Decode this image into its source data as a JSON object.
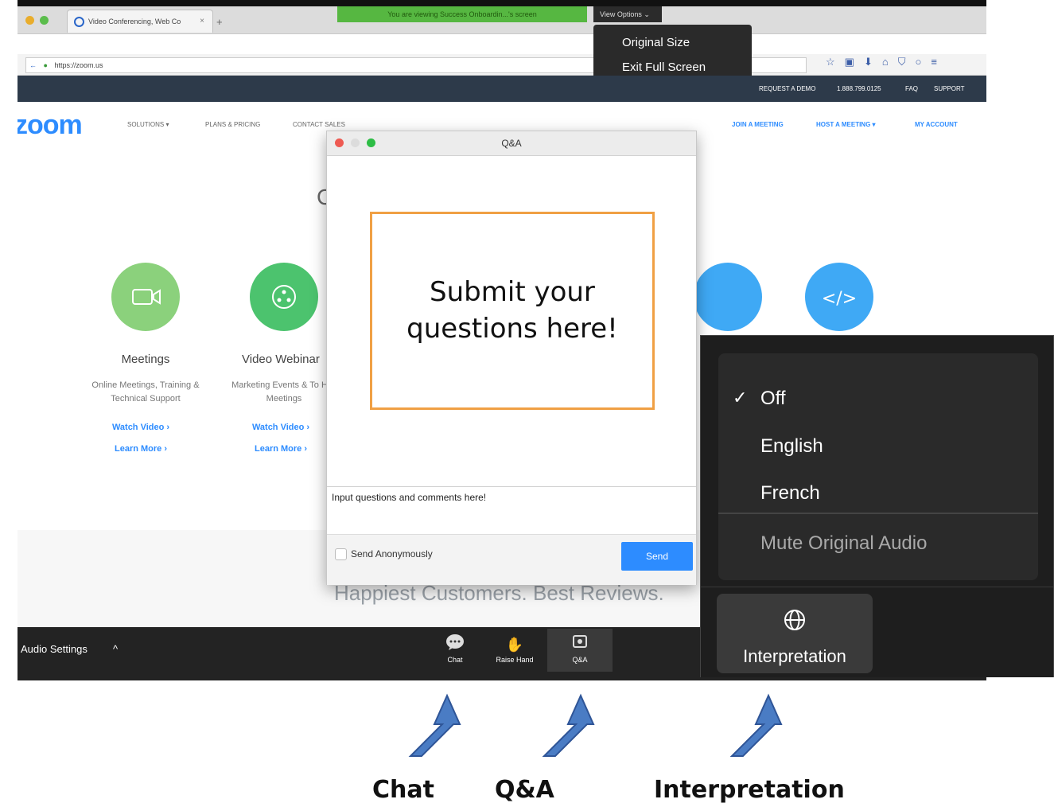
{
  "browser": {
    "tab_title": "Video Conferencing, Web Co",
    "tab_close": "×",
    "new_tab": "+",
    "url": "https://zoom.us",
    "share_notice": "You are viewing Success Onboardin...'s screen",
    "view_options": "View Options ⌄",
    "view_menu": [
      "Original Size",
      "Exit Full Screen"
    ]
  },
  "website": {
    "top_links": [
      "REQUEST A DEMO",
      "1.888.799.0125",
      "FAQ",
      "SUPPORT"
    ],
    "logo": "zoom",
    "nav": [
      "SOLUTIONS ▾",
      "PLANS & PRICING",
      "CONTACT SALES"
    ],
    "nav_right": [
      "JOIN A MEETING",
      "HOST A MEETING ▾",
      "MY ACCOUNT"
    ],
    "products": [
      {
        "title": "Meetings",
        "desc": "Online Meetings, Training & Technical Support",
        "watch": "Watch Video ›",
        "learn": "Learn More ›"
      },
      {
        "title": "Video Webinar",
        "desc": "Marketing Events & To Hall Meetings",
        "watch": "Watch Video ›",
        "learn": "Learn More ›"
      }
    ],
    "tagline": "Happiest Customers. Best Reviews.",
    "colors": {
      "brand": "#2d8cff",
      "meetings_circle": "#8bd17c",
      "webinar_circle": "#4cc36e"
    }
  },
  "zoom_toolbar": {
    "audio_settings": "Audio Settings",
    "caret": "^",
    "buttons": [
      {
        "label": "Chat",
        "icon": "chat-icon"
      },
      {
        "label": "Raise Hand",
        "icon": "raise-hand-icon"
      },
      {
        "label": "Q&A",
        "icon": "qa-icon"
      }
    ]
  },
  "qa_dialog": {
    "title": "Q&A",
    "input_placeholder": "Input questions and comments here!",
    "send_anonymously": "Send Anonymously",
    "send": "Send"
  },
  "callout": {
    "text": "Submit your\nquestions here!"
  },
  "interpretation": {
    "options": [
      "Off",
      "English",
      "French"
    ],
    "selected": "Off",
    "mute_original": "Mute Original Audio",
    "button_label": "Interpretation"
  },
  "captions": [
    "Chat",
    "Q&A",
    "Interpretation"
  ]
}
